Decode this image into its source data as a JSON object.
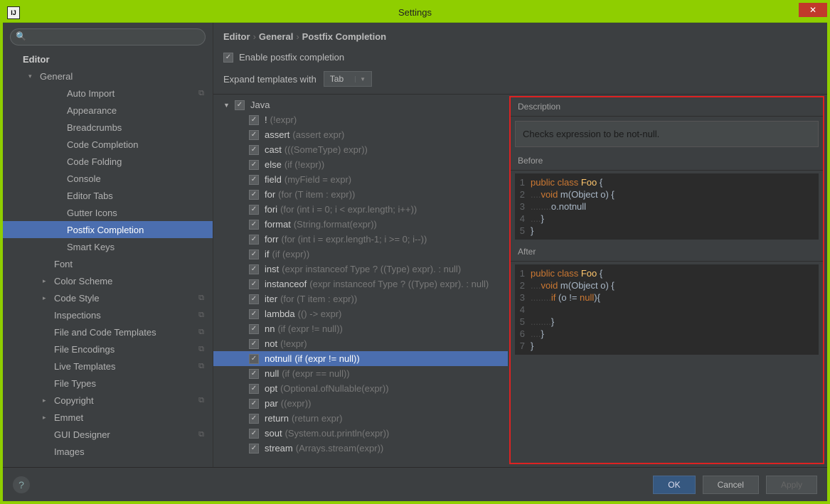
{
  "window": {
    "title": "Settings"
  },
  "search": {
    "placeholder": ""
  },
  "sidebar": {
    "header": "Editor",
    "items": [
      {
        "label": "General",
        "depth": 1,
        "expander": "▾",
        "selected": false
      },
      {
        "label": "Auto Import",
        "depth": 3,
        "copy": true
      },
      {
        "label": "Appearance",
        "depth": 3
      },
      {
        "label": "Breadcrumbs",
        "depth": 3
      },
      {
        "label": "Code Completion",
        "depth": 3
      },
      {
        "label": "Code Folding",
        "depth": 3
      },
      {
        "label": "Console",
        "depth": 3
      },
      {
        "label": "Editor Tabs",
        "depth": 3
      },
      {
        "label": "Gutter Icons",
        "depth": 3
      },
      {
        "label": "Postfix Completion",
        "depth": 3,
        "selected": true
      },
      {
        "label": "Smart Keys",
        "depth": 3
      },
      {
        "label": "Font",
        "depth": 2
      },
      {
        "label": "Color Scheme",
        "depth": 2,
        "expander": "▸"
      },
      {
        "label": "Code Style",
        "depth": 2,
        "expander": "▸",
        "copy": true
      },
      {
        "label": "Inspections",
        "depth": 2,
        "copy": true
      },
      {
        "label": "File and Code Templates",
        "depth": 2,
        "copy": true
      },
      {
        "label": "File Encodings",
        "depth": 2,
        "copy": true
      },
      {
        "label": "Live Templates",
        "depth": 2,
        "copy": true
      },
      {
        "label": "File Types",
        "depth": 2
      },
      {
        "label": "Copyright",
        "depth": 2,
        "expander": "▸",
        "copy": true
      },
      {
        "label": "Emmet",
        "depth": 2,
        "expander": "▸"
      },
      {
        "label": "GUI Designer",
        "depth": 2,
        "copy": true
      },
      {
        "label": "Images",
        "depth": 2
      }
    ]
  },
  "breadcrumb": [
    "Editor",
    "General",
    "Postfix Completion"
  ],
  "enable_label": "Enable postfix completion",
  "expand_label": "Expand templates with",
  "expand_value": "Tab",
  "language": "Java",
  "templates": [
    {
      "name": "!",
      "hint": "(!expr)"
    },
    {
      "name": "assert",
      "hint": "(assert expr)"
    },
    {
      "name": "cast",
      "hint": "(((SomeType) expr))"
    },
    {
      "name": "else",
      "hint": "(if (!expr))"
    },
    {
      "name": "field",
      "hint": "(myField = expr)"
    },
    {
      "name": "for",
      "hint": "(for (T item : expr))"
    },
    {
      "name": "fori",
      "hint": "(for (int i = 0; i < expr.length; i++))"
    },
    {
      "name": "format",
      "hint": "(String.format(expr))"
    },
    {
      "name": "forr",
      "hint": "(for (int i = expr.length-1; i >= 0; i--))"
    },
    {
      "name": "if",
      "hint": "(if (expr))"
    },
    {
      "name": "inst",
      "hint": "(expr instanceof Type ? ((Type) expr). : null)"
    },
    {
      "name": "instanceof",
      "hint": "(expr instanceof Type ? ((Type) expr). : null)"
    },
    {
      "name": "iter",
      "hint": "(for (T item : expr))"
    },
    {
      "name": "lambda",
      "hint": "(() -> expr)"
    },
    {
      "name": "nn",
      "hint": "(if (expr != null))"
    },
    {
      "name": "not",
      "hint": "(!expr)"
    },
    {
      "name": "notnull",
      "hint": "(if (expr != null))",
      "selected": true
    },
    {
      "name": "null",
      "hint": "(if (expr == null))"
    },
    {
      "name": "opt",
      "hint": "(Optional.ofNullable(expr))"
    },
    {
      "name": "par",
      "hint": "((expr))"
    },
    {
      "name": "return",
      "hint": "(return expr)"
    },
    {
      "name": "sout",
      "hint": "(System.out.println(expr))"
    },
    {
      "name": "stream",
      "hint": "(Arrays.stream(expr))"
    }
  ],
  "preview": {
    "desc_label": "Description",
    "description": "Checks expression to be not-null.",
    "before_label": "Before",
    "after_label": "After",
    "before": [
      [
        {
          "t": "public ",
          "c": "kw"
        },
        {
          "t": "class ",
          "c": "kw"
        },
        {
          "t": "Foo ",
          "c": "ident"
        },
        {
          "t": "{",
          "c": "plain"
        }
      ],
      [
        {
          "t": "....",
          "c": "dots"
        },
        {
          "t": "void ",
          "c": "kw"
        },
        {
          "t": "m(Object o) {",
          "c": "plain"
        }
      ],
      [
        {
          "t": "........",
          "c": "dots"
        },
        {
          "t": "o.notnull",
          "c": "plain"
        }
      ],
      [
        {
          "t": "....",
          "c": "dots"
        },
        {
          "t": "}",
          "c": "plain"
        }
      ],
      [
        {
          "t": "}",
          "c": "plain"
        }
      ]
    ],
    "after": [
      [
        {
          "t": "public ",
          "c": "kw"
        },
        {
          "t": "class ",
          "c": "kw"
        },
        {
          "t": "Foo ",
          "c": "ident"
        },
        {
          "t": "{",
          "c": "plain"
        }
      ],
      [
        {
          "t": "....",
          "c": "dots"
        },
        {
          "t": "void ",
          "c": "kw"
        },
        {
          "t": "m(Object o) {",
          "c": "plain"
        }
      ],
      [
        {
          "t": "........",
          "c": "dots"
        },
        {
          "t": "if ",
          "c": "kw"
        },
        {
          "t": "(o != ",
          "c": "plain"
        },
        {
          "t": "null",
          "c": "kw"
        },
        {
          "t": "){",
          "c": "plain"
        }
      ],
      [
        {
          "t": "",
          "c": "plain"
        }
      ],
      [
        {
          "t": "........",
          "c": "dots"
        },
        {
          "t": "}",
          "c": "plain"
        }
      ],
      [
        {
          "t": "....",
          "c": "dots"
        },
        {
          "t": "}",
          "c": "plain"
        }
      ],
      [
        {
          "t": "}",
          "c": "plain"
        }
      ]
    ]
  },
  "footer": {
    "ok": "OK",
    "cancel": "Cancel",
    "apply": "Apply"
  }
}
